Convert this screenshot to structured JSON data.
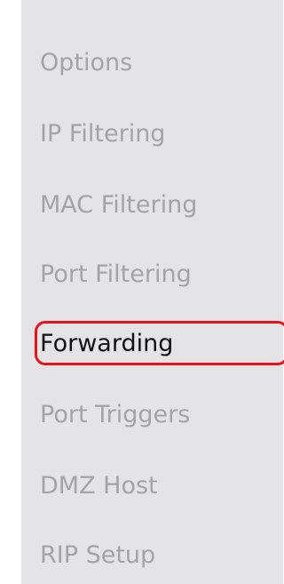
{
  "sidebar": {
    "items": [
      {
        "label": "Options"
      },
      {
        "label": "IP Filtering"
      },
      {
        "label": "MAC Filtering"
      },
      {
        "label": "Port Filtering"
      },
      {
        "label": "Forwarding",
        "highlighted": true
      },
      {
        "label": "Port Triggers"
      },
      {
        "label": "DMZ Host"
      },
      {
        "label": "RIP Setup"
      }
    ]
  },
  "colors": {
    "sidebar_background": "#e4e4e6",
    "inactive_text": "#a4a4a4",
    "active_text": "#111111",
    "highlight_ring": "#e8121c"
  }
}
